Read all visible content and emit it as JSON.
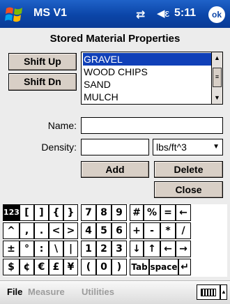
{
  "titlebar": {
    "app_title": "MS V1",
    "time": "5:11",
    "ok_label": "ok",
    "connectivity_icon": "connectivity-icon",
    "volume_icon": "volume-icon"
  },
  "form": {
    "title": "Stored Material Properties",
    "shift_up_label": "Shift Up",
    "shift_dn_label": "Shift Dn",
    "materials": [
      "GRAVEL",
      "WOOD CHIPS",
      "SAND",
      "MULCH"
    ],
    "selected_index": 0,
    "name_label": "Name:",
    "name_value": "",
    "density_label": "Density:",
    "density_value": "",
    "units_value": "lbs/ft^3",
    "add_label": "Add",
    "delete_label": "Delete",
    "close_label": "Close"
  },
  "keyboard": {
    "rows": [
      [
        "123",
        "[",
        "]",
        "{",
        "}",
        "7",
        "8",
        "9",
        "#",
        "%",
        "=",
        "←"
      ],
      [
        "^",
        ",",
        ".",
        "<",
        ">",
        "4",
        "5",
        "6",
        "+",
        "-",
        "*",
        "/"
      ],
      [
        "±",
        "°",
        ":",
        "\\",
        "|",
        "1",
        "2",
        "3",
        "↓",
        "↑",
        "←",
        "→"
      ],
      [
        "$",
        "¢",
        "€",
        "£",
        "¥",
        "(",
        "0",
        ")",
        "Tab",
        "space",
        "↵"
      ]
    ]
  },
  "menubar": {
    "file": "File",
    "measure": "Measure",
    "utilities": "Utilities"
  },
  "colors": {
    "titlebar": "#0b45a8",
    "selection": "#1040b8",
    "button_face": "#d8cfc6",
    "background": "#ececec"
  }
}
